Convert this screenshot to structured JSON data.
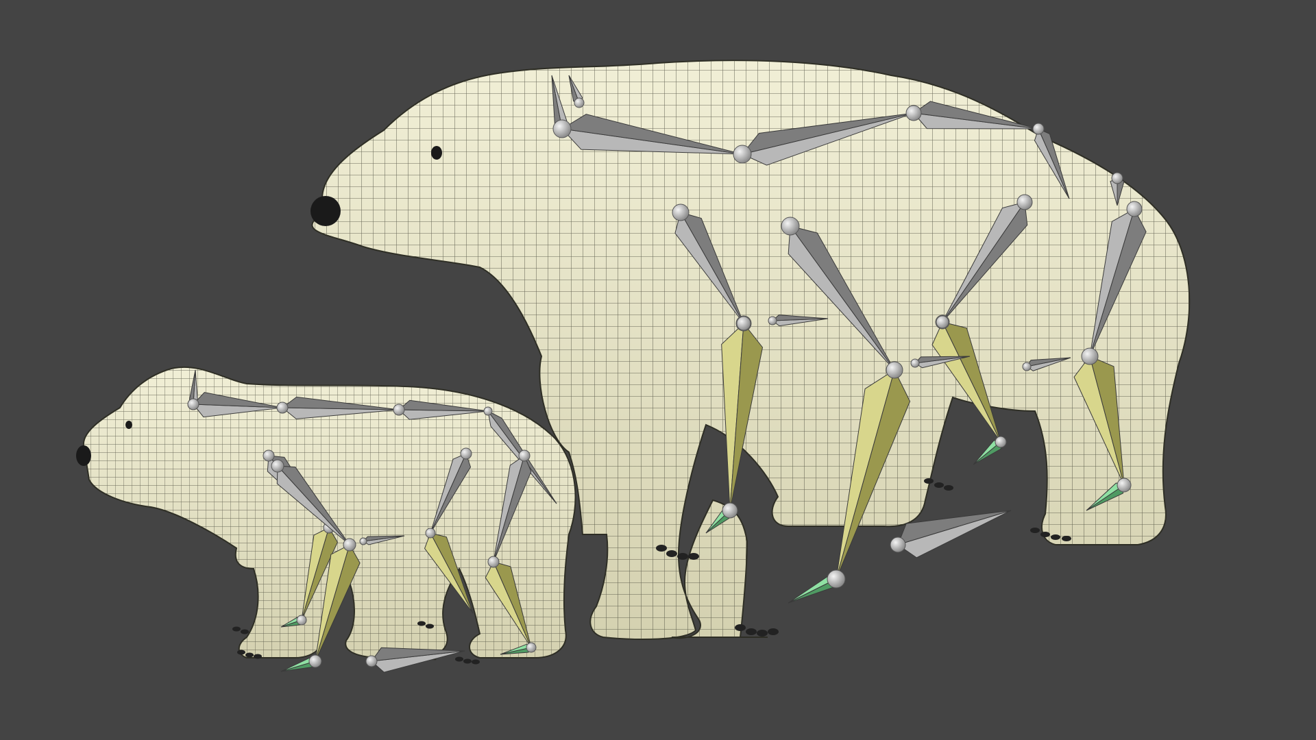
{
  "viewport": {
    "background": "#444444"
  },
  "colors": {
    "mesh_fill": "#e9e6c8",
    "mesh_shadow": "#c9c6a6",
    "wire": "#3c3c30",
    "bone_gray": "#b8b8b8",
    "bone_gray_dark": "#7d7d7d",
    "bone_yellow": "#d8d68c",
    "bone_yellow_dark": "#9a984e",
    "bone_green": "#8fe0a3",
    "joint": "#d0d0d0",
    "nose": "#1a1a1a",
    "claw": "#222222"
  },
  "objects": [
    {
      "name": "adult-polar-bear",
      "icon": "bear-mesh-icon"
    },
    {
      "name": "cub-polar-bear",
      "icon": "bear-mesh-icon"
    }
  ]
}
